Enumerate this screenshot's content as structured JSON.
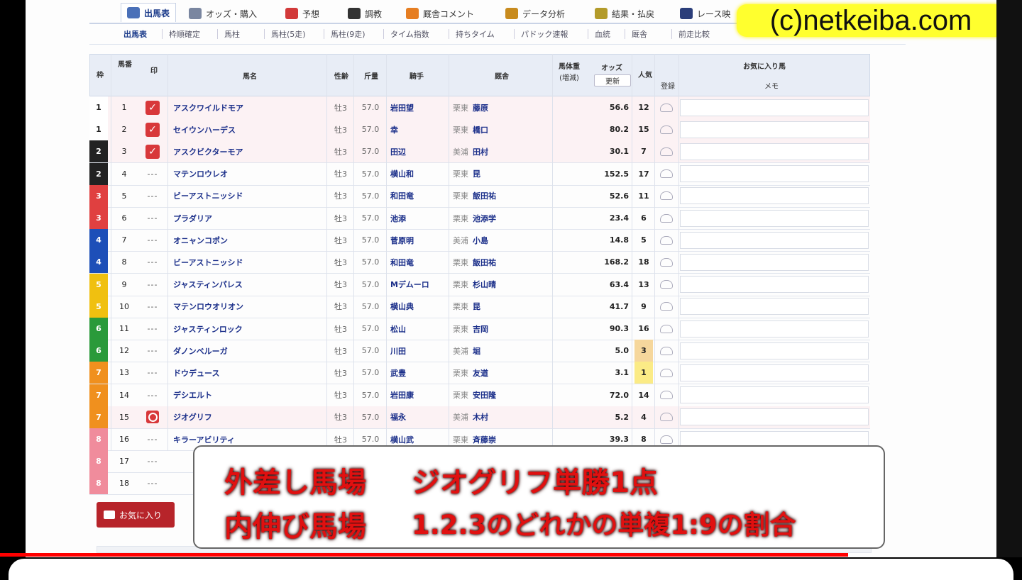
{
  "watermark": "(c)netkeiba.com",
  "tabs": [
    {
      "label": "出馬表",
      "icon": "table-icon",
      "color": "#4a70b8",
      "active": true
    },
    {
      "label": "オッズ・購入",
      "icon": "odds-icon",
      "color": "#7a86a0",
      "active": false
    },
    {
      "label": "予想",
      "icon": "prediction-icon",
      "color": "#d23a3a",
      "active": false
    },
    {
      "label": "調教",
      "icon": "training-icon",
      "color": "#333333",
      "active": false
    },
    {
      "label": "厩舎コメント",
      "icon": "comment-icon",
      "color": "#e67e22",
      "active": false
    },
    {
      "label": "データ分析",
      "icon": "chart-icon",
      "color": "#c88b1e",
      "active": false
    },
    {
      "label": "結果・払戻",
      "icon": "result-icon",
      "color": "#b39b2a",
      "active": false
    },
    {
      "label": "レース映",
      "icon": "video-icon",
      "color": "#2b3e7a",
      "active": false
    }
  ],
  "subtabs": [
    "出馬表",
    "枠順確定",
    "馬柱",
    "馬柱(5走)",
    "馬柱(9走)",
    "タイム指数",
    "持ちタイム",
    "パドック速報",
    "血統",
    "厩舎",
    "前走比較"
  ],
  "header": {
    "waku": "枠",
    "umaban": "馬番",
    "mark": "印",
    "mark_sub": "印",
    "horse": "馬名",
    "sex": "性齢",
    "weight": "斤量",
    "jockey": "騎手",
    "trainer": "厩舎",
    "body_weight": "馬体重",
    "body_weight_sub": "(増減)",
    "odds": "オッズ",
    "odds_sub": "更新",
    "popularity": "人気",
    "favorite": "お気に入り馬",
    "fav_reg": "登録",
    "memo": "メモ"
  },
  "rows": [
    {
      "waku": "1",
      "waku_color": "#ffffff",
      "waku_text": "#222222",
      "num": "1",
      "mark": "check",
      "name": "アスクワイルドモア",
      "sex": "牡3",
      "weight": "57.0",
      "jockey": "岩田望",
      "area": "栗東",
      "trainer": "藤原",
      "odds": "56.6",
      "pop": "12",
      "hl": true
    },
    {
      "waku": "1",
      "waku_color": "#ffffff",
      "waku_text": "#222222",
      "num": "2",
      "mark": "check",
      "name": "セイウンハーデス",
      "sex": "牡3",
      "weight": "57.0",
      "jockey": "幸",
      "area": "栗東",
      "trainer": "橋口",
      "odds": "80.2",
      "pop": "15",
      "hl": true
    },
    {
      "waku": "2",
      "waku_color": "#222222",
      "waku_text": "#ffffff",
      "num": "3",
      "mark": "check",
      "name": "アスクビクターモア",
      "sex": "牡3",
      "weight": "57.0",
      "jockey": "田辺",
      "area": "美浦",
      "trainer": "田村",
      "odds": "30.1",
      "pop": "7",
      "hl": true
    },
    {
      "waku": "2",
      "waku_color": "#222222",
      "waku_text": "#ffffff",
      "num": "4",
      "mark": "---",
      "name": "マテンロウレオ",
      "sex": "牡3",
      "weight": "57.0",
      "jockey": "横山和",
      "area": "栗東",
      "trainer": "昆",
      "odds": "152.5",
      "pop": "17",
      "hl": false
    },
    {
      "waku": "3",
      "waku_color": "#e04040",
      "waku_text": "#ffffff",
      "num": "5",
      "mark": "---",
      "name": "ビーアストニッシド",
      "sex": "牡3",
      "weight": "57.0",
      "jockey": "和田竜",
      "area": "栗東",
      "trainer": "飯田祐",
      "odds": "52.6",
      "pop": "11",
      "hl": false
    },
    {
      "waku": "3",
      "waku_color": "#e04040",
      "waku_text": "#ffffff",
      "num": "6",
      "mark": "---",
      "name": "プラダリア",
      "sex": "牡3",
      "weight": "57.0",
      "jockey": "池添",
      "area": "栗東",
      "trainer": "池添学",
      "odds": "23.4",
      "pop": "6",
      "hl": false
    },
    {
      "waku": "4",
      "waku_color": "#1d4fb8",
      "waku_text": "#ffffff",
      "num": "7",
      "mark": "---",
      "name": "オニャンコポン",
      "sex": "牡3",
      "weight": "57.0",
      "jockey": "菅原明",
      "area": "美浦",
      "trainer": "小島",
      "odds": "14.8",
      "pop": "5",
      "hl": false
    },
    {
      "waku": "4",
      "waku_color": "#1d4fb8",
      "waku_text": "#ffffff",
      "num": "8",
      "mark": "---",
      "name": "ビーアストニッシド",
      "sex": "牡3",
      "weight": "57.0",
      "jockey": "和田竜",
      "area": "栗東",
      "trainer": "飯田祐",
      "odds": "168.2",
      "pop": "18",
      "hl": false
    },
    {
      "waku": "5",
      "waku_color": "#f0c010",
      "waku_text": "#ffffff",
      "num": "9",
      "mark": "---",
      "name": "ジャスティンパレス",
      "sex": "牡3",
      "weight": "57.0",
      "jockey": "Mデムーロ",
      "area": "栗東",
      "trainer": "杉山晴",
      "odds": "63.4",
      "pop": "13",
      "hl": false
    },
    {
      "waku": "5",
      "waku_color": "#f0c010",
      "waku_text": "#ffffff",
      "num": "10",
      "mark": "---",
      "name": "マテンロウオリオン",
      "sex": "牡3",
      "weight": "57.0",
      "jockey": "横山典",
      "area": "栗東",
      "trainer": "昆",
      "odds": "41.7",
      "pop": "9",
      "hl": false
    },
    {
      "waku": "6",
      "waku_color": "#2a9a3a",
      "waku_text": "#ffffff",
      "num": "11",
      "mark": "---",
      "name": "ジャスティンロック",
      "sex": "牡3",
      "weight": "57.0",
      "jockey": "松山",
      "area": "栗東",
      "trainer": "吉岡",
      "odds": "90.3",
      "pop": "16",
      "hl": false
    },
    {
      "waku": "6",
      "waku_color": "#2a9a3a",
      "waku_text": "#ffffff",
      "num": "12",
      "mark": "---",
      "name": "ダノンベルーガ",
      "sex": "牡3",
      "weight": "57.0",
      "jockey": "川田",
      "area": "美浦",
      "trainer": "堀",
      "odds": "5.0",
      "pop": "3",
      "pop_class": "p1",
      "hl": false
    },
    {
      "waku": "7",
      "waku_color": "#f0901e",
      "waku_text": "#ffffff",
      "num": "13",
      "mark": "---",
      "name": "ドウデュース",
      "sex": "牡3",
      "weight": "57.0",
      "jockey": "武豊",
      "area": "栗東",
      "trainer": "友道",
      "odds": "3.1",
      "pop": "1",
      "pop_class": "p2",
      "hl": false
    },
    {
      "waku": "7",
      "waku_color": "#f0901e",
      "waku_text": "#ffffff",
      "num": "14",
      "mark": "---",
      "name": "デシエルト",
      "sex": "牡3",
      "weight": "57.0",
      "jockey": "岩田康",
      "area": "栗東",
      "trainer": "安田隆",
      "odds": "72.0",
      "pop": "14",
      "hl": false
    },
    {
      "waku": "7",
      "waku_color": "#f0901e",
      "waku_text": "#ffffff",
      "num": "15",
      "mark": "circle",
      "name": "ジオグリフ",
      "sex": "牡3",
      "weight": "57.0",
      "jockey": "福永",
      "area": "美浦",
      "trainer": "木村",
      "odds": "5.2",
      "pop": "4",
      "hl": true
    },
    {
      "waku": "8",
      "waku_color": "#f08c9c",
      "waku_text": "#ffffff",
      "num": "16",
      "mark": "---",
      "name": "キラーアビリティ",
      "sex": "牡3",
      "weight": "57.0",
      "jockey": "横山武",
      "area": "栗東",
      "trainer": "斉藤崇",
      "odds": "39.3",
      "pop": "8",
      "hl": false
    },
    {
      "waku": "8",
      "waku_color": "#f08c9c",
      "waku_text": "#ffffff",
      "num": "17",
      "mark": "---",
      "name": "",
      "sex": "",
      "weight": "",
      "jockey": "",
      "area": "",
      "trainer": "",
      "odds": "",
      "pop": "",
      "hl": false
    },
    {
      "waku": "8",
      "waku_color": "#f08c9c",
      "waku_text": "#ffffff",
      "num": "18",
      "mark": "---",
      "name": "",
      "sex": "",
      "weight": "",
      "jockey": "",
      "area": "",
      "trainer": "",
      "odds": "",
      "pop": "",
      "hl": false
    }
  ],
  "button": {
    "label": "お気に入り"
  },
  "overlay": {
    "line1_a": "外差し馬場",
    "line1_b": "ジオグリフ単勝1点",
    "line2_a": "内伸び馬場",
    "line2_b": "1.2.3のどれかの単複1:9の割合"
  },
  "video": {
    "progress": 0.83
  }
}
